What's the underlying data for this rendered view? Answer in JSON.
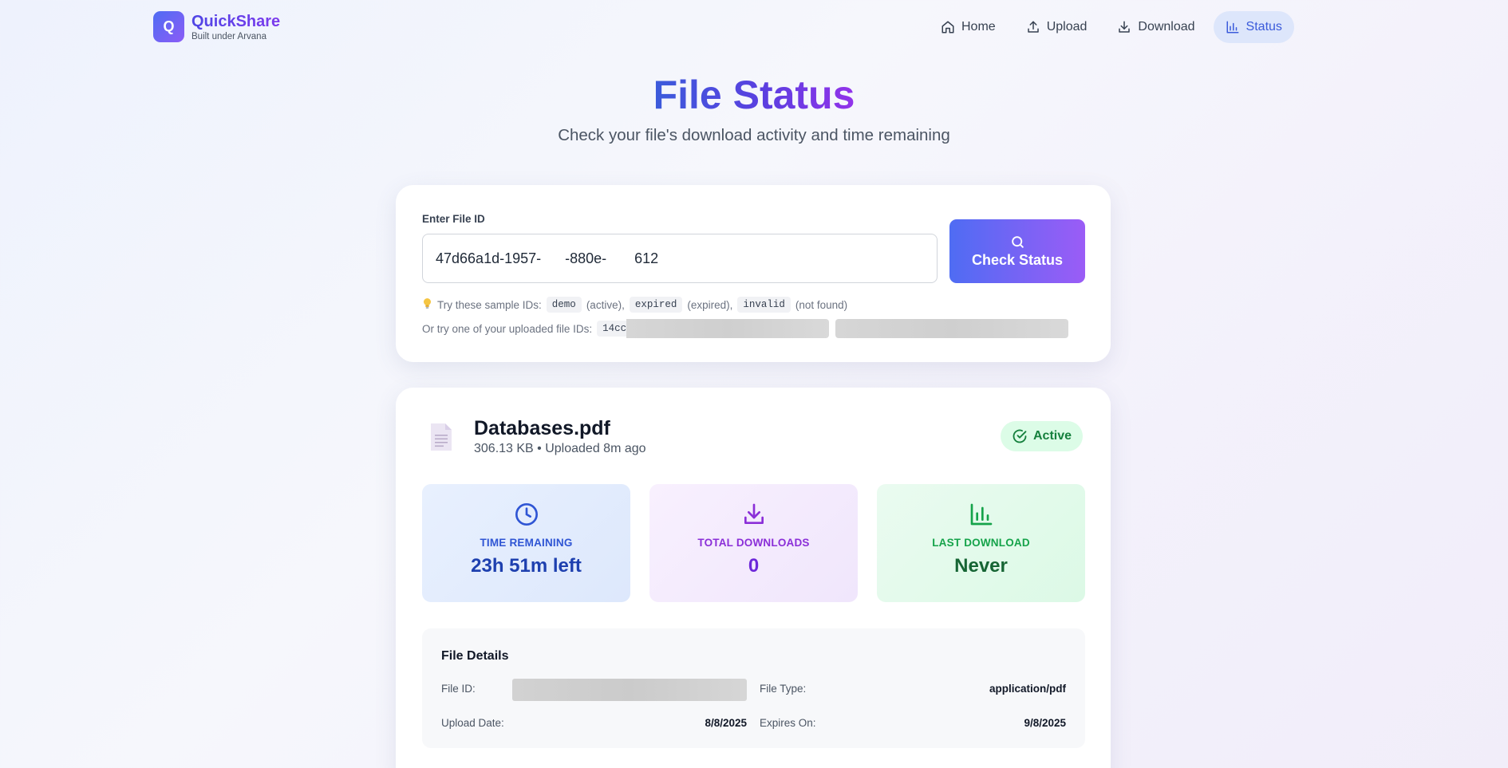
{
  "header": {
    "logo_letter": "Q",
    "brand_name": "QuickShare",
    "brand_sub": "Built under Arvana",
    "nav": [
      {
        "label": "Home",
        "icon": "home-icon"
      },
      {
        "label": "Upload",
        "icon": "upload-icon"
      },
      {
        "label": "Download",
        "icon": "download-icon"
      },
      {
        "label": "Status",
        "icon": "bar-chart-icon",
        "active": true
      }
    ]
  },
  "hero": {
    "title": "File Status",
    "subtitle": "Check your file's download activity and time remaining"
  },
  "search": {
    "label": "Enter File ID",
    "value": "47d66a1d-1957-      -880e-       612",
    "button_label": "Check Status",
    "hint_prefix": "Try these sample IDs:",
    "samples": [
      {
        "id": "demo",
        "note": "(active),"
      },
      {
        "id": "expired",
        "note": "(expired),"
      },
      {
        "id": "invalid",
        "note": "(not found)"
      }
    ],
    "uploaded_prefix": "Or try one of your uploaded file IDs:",
    "uploaded_partial": "14cc"
  },
  "result": {
    "file_name": "Databases.pdf",
    "file_meta": "306.13 KB • Uploaded 8m ago",
    "status": "Active",
    "stats": {
      "time_label": "TIME REMAINING",
      "time_value": "23h 51m left",
      "downloads_label": "TOTAL DOWNLOADS",
      "downloads_value": "0",
      "last_label": "LAST DOWNLOAD",
      "last_value": "Never"
    },
    "details": {
      "title": "File Details",
      "file_id_label": "File ID:",
      "file_type_label": "File Type:",
      "file_type_value": "application/pdf",
      "upload_date_label": "Upload Date:",
      "upload_date_value": "8/8/2025",
      "expires_label": "Expires On:",
      "expires_value": "9/8/2025"
    }
  },
  "colors": {
    "accent": "#3b5bdb",
    "accent_purple": "#9333ea",
    "active_green": "#15803d"
  }
}
